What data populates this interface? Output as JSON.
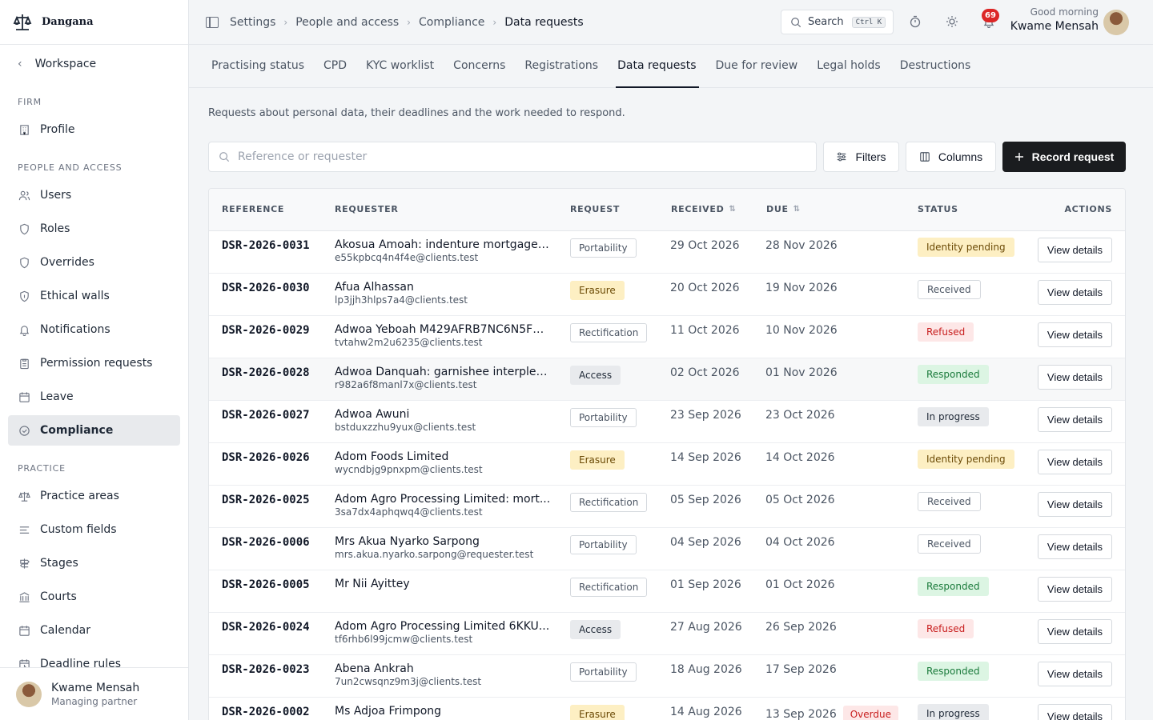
{
  "brand": {
    "name": "Dangana"
  },
  "sidebar": {
    "back_label": "Workspace",
    "sections": {
      "firm": "FIRM",
      "people": "PEOPLE AND ACCESS",
      "practice": "PRACTICE"
    },
    "items": [
      {
        "label": "Profile",
        "icon": "building-icon"
      },
      {
        "label": "Users",
        "icon": "users-icon"
      },
      {
        "label": "Roles",
        "icon": "shield-icon"
      },
      {
        "label": "Overrides",
        "icon": "shield-icon"
      },
      {
        "label": "Ethical walls",
        "icon": "shield-lock-icon"
      },
      {
        "label": "Notifications",
        "icon": "bell-icon"
      },
      {
        "label": "Permission requests",
        "icon": "clipboard-icon"
      },
      {
        "label": "Leave",
        "icon": "calendar-icon"
      },
      {
        "label": "Compliance",
        "icon": "check-circle-icon",
        "active": true
      },
      {
        "label": "Practice areas",
        "icon": "scale-icon"
      },
      {
        "label": "Custom fields",
        "icon": "list-icon"
      },
      {
        "label": "Stages",
        "icon": "signpost-icon"
      },
      {
        "label": "Courts",
        "icon": "courthouse-icon"
      },
      {
        "label": "Calendar",
        "icon": "calendar-icon"
      },
      {
        "label": "Deadline rules",
        "icon": "calendar-clock-icon"
      }
    ],
    "user": {
      "name": "Kwame Mensah",
      "role": "Managing partner"
    }
  },
  "topbar": {
    "breadcrumbs": [
      "Settings",
      "People and access",
      "Compliance",
      "Data requests"
    ],
    "search_label": "Search",
    "search_shortcut": "Ctrl K",
    "notification_count": "69",
    "greeting": "Good morning",
    "user_name": "Kwame Mensah"
  },
  "tabs": [
    {
      "label": "Practising status"
    },
    {
      "label": "CPD"
    },
    {
      "label": "KYC worklist"
    },
    {
      "label": "Concerns"
    },
    {
      "label": "Registrations"
    },
    {
      "label": "Data requests",
      "active": true
    },
    {
      "label": "Due for review"
    },
    {
      "label": "Legal holds"
    },
    {
      "label": "Destructions"
    }
  ],
  "description": "Requests about personal data, their deadlines and the work needed to respond.",
  "filters": {
    "search_placeholder": "Reference or requester",
    "filters_label": "Filters",
    "columns_label": "Columns",
    "record_label": "Record request"
  },
  "table": {
    "headers": {
      "reference": "REFERENCE",
      "requester": "REQUESTER",
      "request": "REQUEST",
      "received": "RECEIVED",
      "due": "DUE",
      "status": "STATUS",
      "actions": "ACTIONS"
    },
    "action_label": "View details",
    "rows": [
      {
        "ref": "DSR-2026-0031",
        "name": "Akosua Amoah: indenture mortgage ...",
        "email": "e55kpbcq4n4f4e@clients.test",
        "type": "Portability",
        "received": "29 Oct 2026",
        "due": "28 Nov 2026",
        "status": "Identity pending",
        "overdue": ""
      },
      {
        "ref": "DSR-2026-0030",
        "name": "Afua Alhassan",
        "email": "lp3jjh3hlps7a4@clients.test",
        "type": "Erasure",
        "received": "20 Oct 2026",
        "due": "19 Nov 2026",
        "status": "Received",
        "overdue": ""
      },
      {
        "ref": "DSR-2026-0029",
        "name": "Adwoa Yeboah M429AFRB7NC6N5FG...",
        "email": "tvtahw2m2u6235@clients.test",
        "type": "Rectification",
        "received": "11 Oct 2026",
        "due": "10 Nov 2026",
        "status": "Refused",
        "overdue": ""
      },
      {
        "ref": "DSR-2026-0028",
        "name": "Adwoa Danquah: garnishee interplea...",
        "email": "r982a6f8manl7x@clients.test",
        "type": "Access",
        "received": "02 Oct 2026",
        "due": "01 Nov 2026",
        "status": "Responded",
        "overdue": "",
        "highlight": true
      },
      {
        "ref": "DSR-2026-0027",
        "name": "Adwoa Awuni",
        "email": "bstduxzzhu9yux@clients.test",
        "type": "Portability",
        "received": "23 Sep 2026",
        "due": "23 Oct 2026",
        "status": "In progress",
        "overdue": ""
      },
      {
        "ref": "DSR-2026-0026",
        "name": "Adom Foods Limited",
        "email": "wycndbjg9pnxpm@clients.test",
        "type": "Erasure",
        "received": "14 Sep 2026",
        "due": "14 Oct 2026",
        "status": "Identity pending",
        "overdue": ""
      },
      {
        "ref": "DSR-2026-0025",
        "name": "Adom Agro Processing Limited: mort...",
        "email": "3sa7dx4aphqwq4@clients.test",
        "type": "Rectification",
        "received": "05 Sep 2026",
        "due": "05 Oct 2026",
        "status": "Received",
        "overdue": ""
      },
      {
        "ref": "DSR-2026-0006",
        "name": "Mrs Akua Nyarko Sarpong",
        "email": "mrs.akua.nyarko.sarpong@requester.test",
        "type": "Portability",
        "received": "04 Sep 2026",
        "due": "04 Oct 2026",
        "status": "Received",
        "overdue": ""
      },
      {
        "ref": "DSR-2026-0005",
        "name": "Mr Nii Ayittey",
        "email": "",
        "type": "Rectification",
        "received": "01 Sep 2026",
        "due": "01 Oct 2026",
        "status": "Responded",
        "overdue": ""
      },
      {
        "ref": "DSR-2026-0024",
        "name": "Adom Agro Processing Limited 6KKU...",
        "email": "tf6rhb6l99jcmw@clients.test",
        "type": "Access",
        "received": "27 Aug 2026",
        "due": "26 Sep 2026",
        "status": "Refused",
        "overdue": ""
      },
      {
        "ref": "DSR-2026-0023",
        "name": "Abena Ankrah",
        "email": "7un2cwsqnz9m3j@clients.test",
        "type": "Portability",
        "received": "18 Aug 2026",
        "due": "17 Sep 2026",
        "status": "Responded",
        "overdue": ""
      },
      {
        "ref": "DSR-2026-0002",
        "name": "Ms Adjoa Frimpong",
        "email": "",
        "type": "Erasure",
        "received": "14 Aug 2026",
        "due": "13 Sep 2026",
        "status": "In progress",
        "overdue": "Overdue"
      }
    ]
  }
}
